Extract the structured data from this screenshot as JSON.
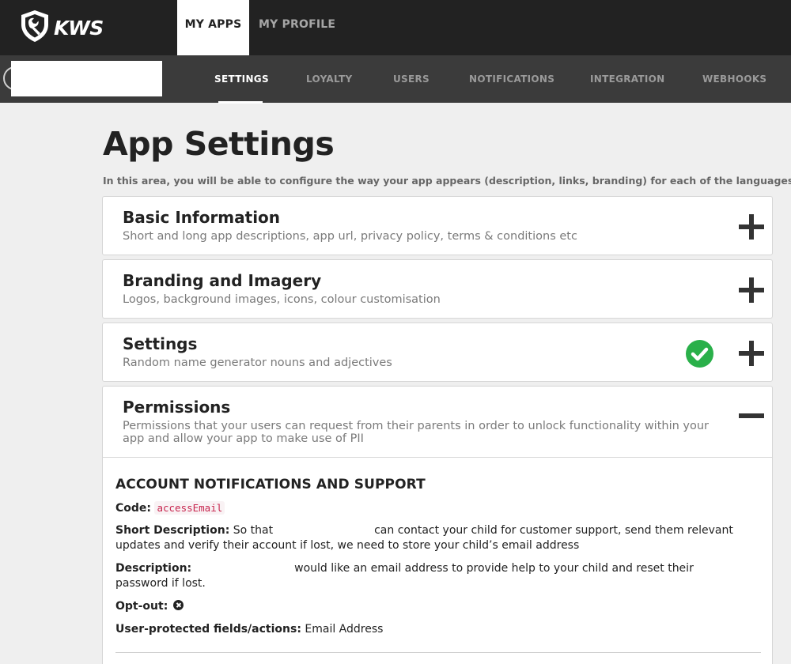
{
  "brand": {
    "logo_text": "KWS",
    "logo_icon": "shield-wrench-icon"
  },
  "topnav": {
    "my_apps": "MY APPS",
    "my_profile": "MY PROFILE"
  },
  "subnav": {
    "tabs": [
      "SETTINGS",
      "LOYALTY",
      "USERS",
      "NOTIFICATIONS",
      "INTEGRATION",
      "WEBHOOKS"
    ],
    "active": "SETTINGS"
  },
  "page": {
    "title": "App Settings",
    "intro": "In this area, you will be able to configure the way your app appears (description, links, branding) for each of the languages you w"
  },
  "panels": [
    {
      "title": "Basic Information",
      "subtitle": "Short and long app descriptions, app url, privacy policy, terms & conditions etc",
      "state": "collapsed"
    },
    {
      "title": "Branding and Imagery",
      "subtitle": "Logos, background images, icons, colour customisation",
      "state": "collapsed"
    },
    {
      "title": "Settings",
      "subtitle": "Random name generator nouns and adjectives",
      "state": "collapsed",
      "status_icon": "check-circle-icon"
    },
    {
      "title": "Permissions",
      "subtitle_line1": "Permissions that your users can request from their parents in order to unlock functionality within your",
      "subtitle_line2": "app and allow your app to make use of PII",
      "state": "expanded"
    }
  ],
  "permission": {
    "heading": "ACCOUNT NOTIFICATIONS AND SUPPORT",
    "code_label": "Code:",
    "code_value": "accessEmail",
    "short_desc_label": "Short Description:",
    "short_desc_pre": "So that",
    "short_desc_post": "can contact your child for customer support, send them relevant",
    "short_desc_line2": "updates and verify their account if lost, we need to store your child’s email address",
    "desc_label": "Description:",
    "desc_post": "would like an email address to provide help to your child and reset their",
    "desc_line2": "password if lost.",
    "optout_label": "Opt-out:",
    "protected_label": "User-protected fields/actions:",
    "protected_value": "Email Address"
  },
  "colors": {
    "topbar": "#222222",
    "subnav": "#3b3b3b",
    "success": "#2ab04a",
    "code": "#c7254e"
  }
}
